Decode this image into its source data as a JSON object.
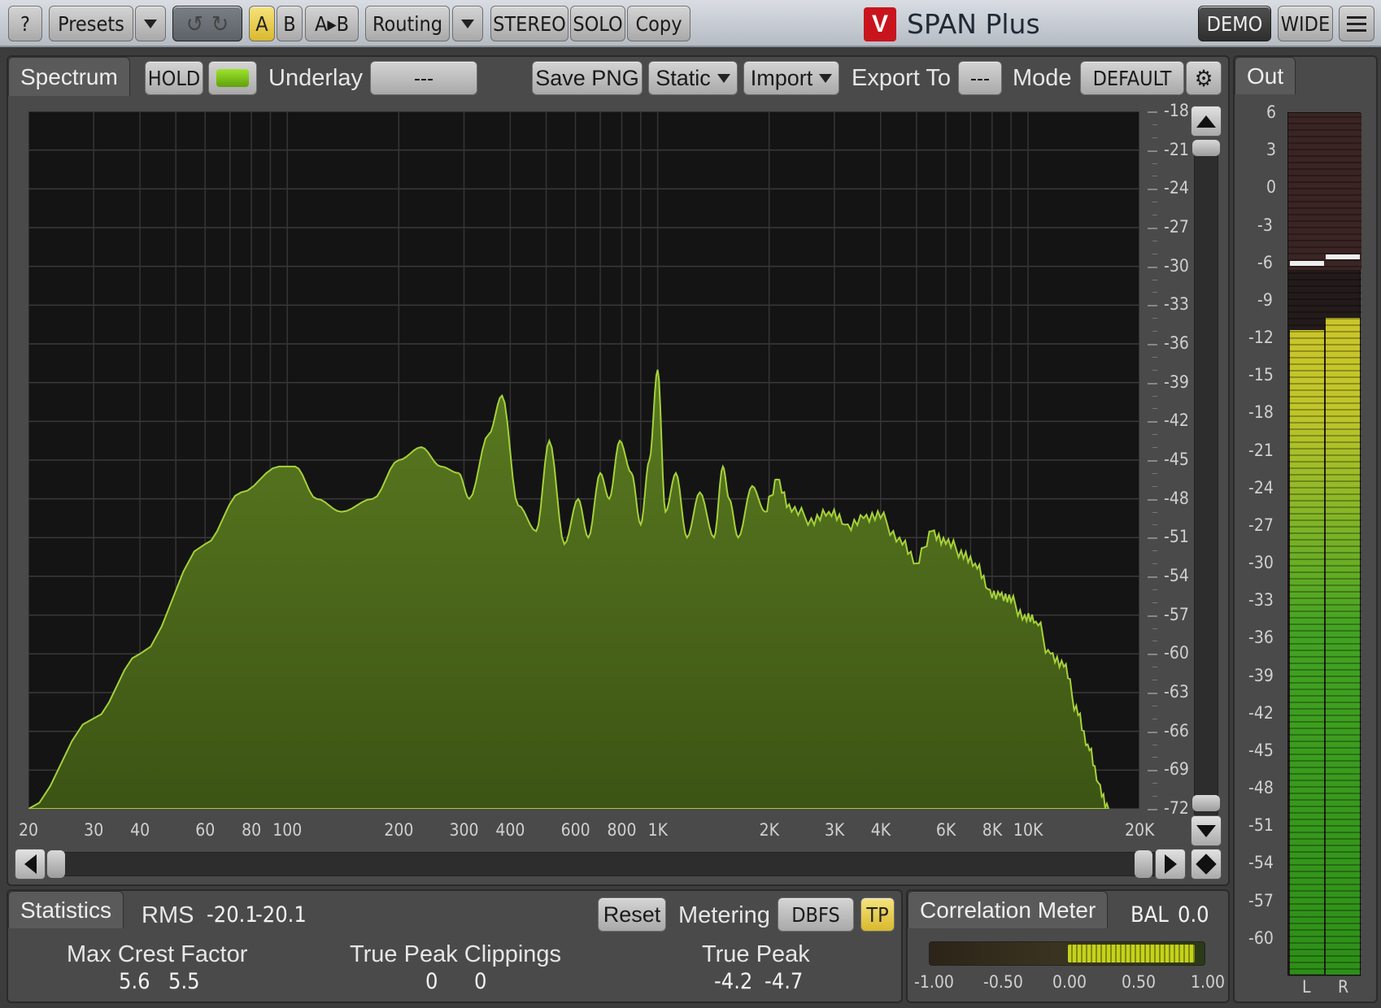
{
  "toolbar": {
    "help": "?",
    "presets": "Presets",
    "a": "A",
    "b": "B",
    "a_to_b": "A▸B",
    "routing": "Routing",
    "stereo": "STEREO",
    "solo": "SOLO",
    "copy": "Copy",
    "app_title": "SPAN Plus",
    "demo": "DEMO",
    "wide": "WIDE"
  },
  "spectrum": {
    "tab": "Spectrum",
    "hold": "HOLD",
    "underlay_label": "Underlay",
    "underlay_value": "---",
    "save_png": "Save PNG",
    "static": "Static",
    "import": "Import",
    "export_to_label": "Export To",
    "export_to_value": "---",
    "mode_label": "Mode",
    "mode_value": "DEFAULT",
    "db_ticks": [
      "-18",
      "-21",
      "-24",
      "-27",
      "-30",
      "-33",
      "-36",
      "-39",
      "-42",
      "-45",
      "-48",
      "-51",
      "-54",
      "-57",
      "-60",
      "-63",
      "-66",
      "-69",
      "-72"
    ],
    "freq_ticks": [
      "20",
      "30",
      "40",
      "60",
      "80",
      "100",
      "200",
      "300",
      "400",
      "600",
      "800",
      "1K",
      "2K",
      "3K",
      "4K",
      "6K",
      "8K",
      "10K",
      "20K"
    ]
  },
  "chart_data": {
    "type": "area",
    "xscale": "log",
    "xlim": [
      20,
      20000
    ],
    "ylim": [
      -72,
      -18
    ],
    "ylabel_unit": "dB",
    "x": [
      20,
      30,
      40,
      60,
      75,
      95,
      105,
      120,
      140,
      170,
      200,
      230,
      260,
      290,
      310,
      350,
      380,
      420,
      470,
      510,
      560,
      610,
      650,
      700,
      740,
      790,
      850,
      900,
      950,
      1000,
      1050,
      1120,
      1200,
      1300,
      1420,
      1500,
      1560,
      1650,
      1800,
      1950,
      2100,
      2300,
      2600,
      2900,
      3200,
      3600,
      4000,
      4500,
      5000,
      5500,
      6000,
      6600,
      7200,
      7800,
      8400,
      9000,
      9800,
      10500,
      11500,
      12500,
      13500,
      14500,
      15500,
      16500
    ],
    "y": [
      -72,
      -65,
      -60,
      -51.5,
      -47.5,
      -45.5,
      -45.5,
      -48,
      -49,
      -48,
      -45,
      -44,
      -45.5,
      -46,
      -48,
      -43,
      -40,
      -48.5,
      -50.5,
      -43.5,
      -51.5,
      -48,
      -51,
      -46,
      -48,
      -43.5,
      -46,
      -50,
      -45,
      -38,
      -49,
      -46,
      -51,
      -47.5,
      -51,
      -45.5,
      -48,
      -51,
      -47,
      -49,
      -46.5,
      -49,
      -49.5,
      -49,
      -50,
      -49.5,
      -49.5,
      -51,
      -53,
      -50.5,
      -51.5,
      -52,
      -53,
      -55,
      -55.5,
      -56,
      -57,
      -57.5,
      -60,
      -61,
      -64,
      -67,
      -70,
      -72
    ],
    "peaks": [
      {
        "freq": 1000,
        "db": -38
      },
      {
        "freq": 420,
        "db": -40
      }
    ]
  },
  "statistics": {
    "tab": "Statistics",
    "rms_label": "RMS",
    "rms_l": "-20.1",
    "rms_r": "-20.1",
    "reset": "Reset",
    "metering_label": "Metering",
    "metering_value": "DBFS",
    "tp": "TP",
    "crest_label": "Max Crest Factor",
    "crest_l": "5.6",
    "crest_r": "5.5",
    "clip_label": "True Peak Clippings",
    "clip_l": "0",
    "clip_r": "0",
    "tp_label": "True Peak",
    "tp_l": "-4.2",
    "tp_r": "-4.7"
  },
  "correlation": {
    "tab": "Correlation Meter",
    "bal_label": "BAL",
    "bal_value": "0.0",
    "scale": [
      "-1.00",
      "-0.50",
      "0.00",
      "0.50",
      "1.00"
    ],
    "range": [
      0.0,
      0.92
    ]
  },
  "out": {
    "tab": "Out",
    "scale": [
      "6",
      "3",
      "0",
      "-3",
      "-6",
      "-9",
      "-12",
      "-15",
      "-18",
      "-21",
      "-24",
      "-27",
      "-30",
      "-33",
      "-36",
      "-39",
      "-42",
      "-45",
      "-48",
      "-51",
      "-54",
      "-57",
      "-60"
    ],
    "channels": [
      "L",
      "R"
    ],
    "level_db": [
      -11.5,
      -10.5
    ],
    "peak_db": [
      -6.0,
      -5.5
    ]
  },
  "colors": {
    "spectrum_fill": "#4e6a1c",
    "spectrum_line": "#a6d13a",
    "meter_yellow": "#e2c22a",
    "meter_green": "#2f9a1a"
  }
}
